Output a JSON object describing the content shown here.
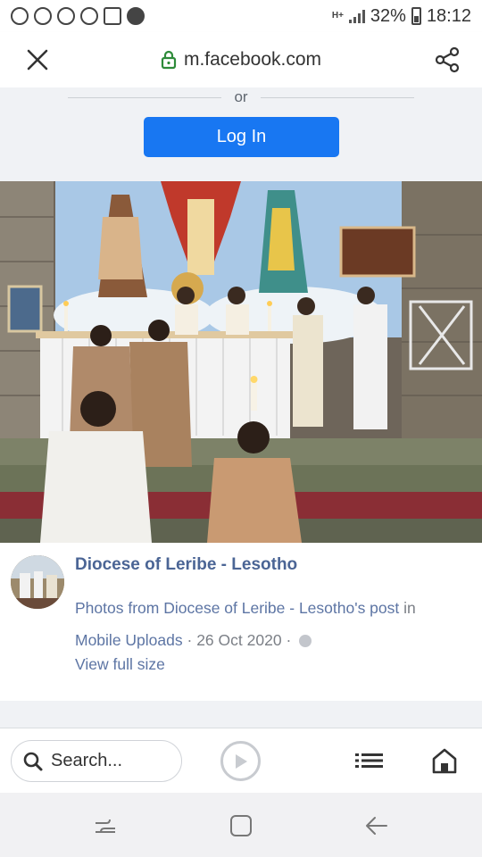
{
  "status_bar": {
    "notification_icons": [
      "whatsapp-icon",
      "facebook-icon",
      "messenger-icon",
      "messenger-icon",
      "gallery-icon",
      "whatsapp-icon"
    ],
    "network": "H+",
    "battery": "32%",
    "time": "18:12"
  },
  "browser": {
    "url": "m.facebook.com",
    "close_icon": "close-icon",
    "share_icon": "share-icon",
    "lock_icon": "lock-icon"
  },
  "login": {
    "divider_text": "or",
    "button_label": "Log In",
    "button_color": "#1877f2"
  },
  "post": {
    "page_name": "Diocese of Leribe - Lesotho",
    "caption_link": "Photos from Diocese of Leribe - Lesotho's post",
    "caption_in": "in",
    "album": "Mobile Uploads",
    "separator": "·",
    "date": "26 Oct 2020",
    "separator2": "·",
    "view_full_size": "View full size",
    "link_color": "#5d75a4"
  },
  "toolbar": {
    "search_placeholder": "Search..."
  }
}
